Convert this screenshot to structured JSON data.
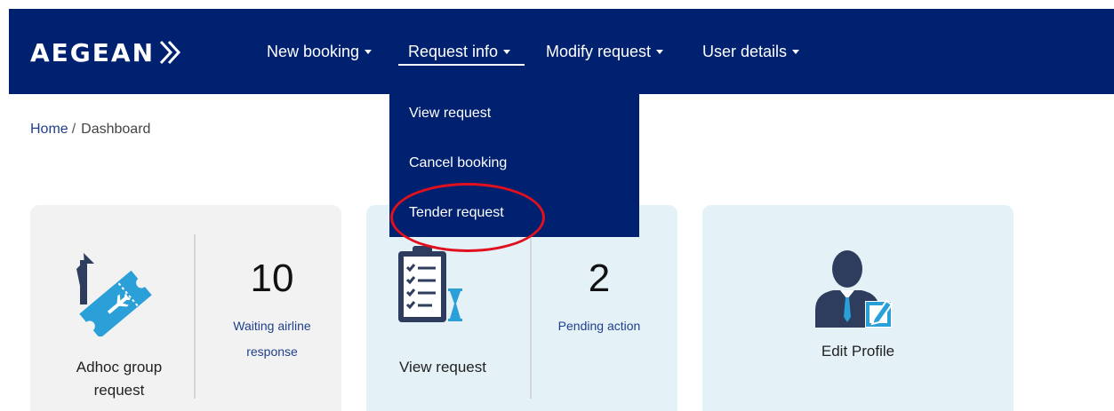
{
  "brand": {
    "name": "AEGEAN"
  },
  "nav": {
    "items": [
      {
        "label": "New booking"
      },
      {
        "label": "Request info"
      },
      {
        "label": "Modify request"
      },
      {
        "label": "User details"
      }
    ],
    "active_index": 1
  },
  "dropdown": {
    "items": [
      {
        "label": "View request"
      },
      {
        "label": "Cancel booking"
      },
      {
        "label": "Tender request",
        "highlighted": true
      }
    ]
  },
  "breadcrumb": {
    "home": "Home",
    "separator": "/",
    "current": "Dashboard"
  },
  "cards": [
    {
      "label_line1": "Adhoc group",
      "label_line2": "request",
      "count": "10",
      "count_line1": "Waiting airline",
      "count_line2": "response",
      "icon": "plane-ticket-icon"
    },
    {
      "label": "View request",
      "count": "2",
      "count_label": "Pending action",
      "icon": "checklist-hourglass-icon"
    },
    {
      "label": "Edit Profile",
      "icon": "user-edit-icon"
    }
  ],
  "colors": {
    "navbar": "#002170",
    "card_gray": "#f2f2f2",
    "card_blue": "#e4f2f8",
    "accent_blue": "#1f3f8c",
    "icon_blue": "#2b9fd8",
    "highlight_red": "#e0101e"
  }
}
